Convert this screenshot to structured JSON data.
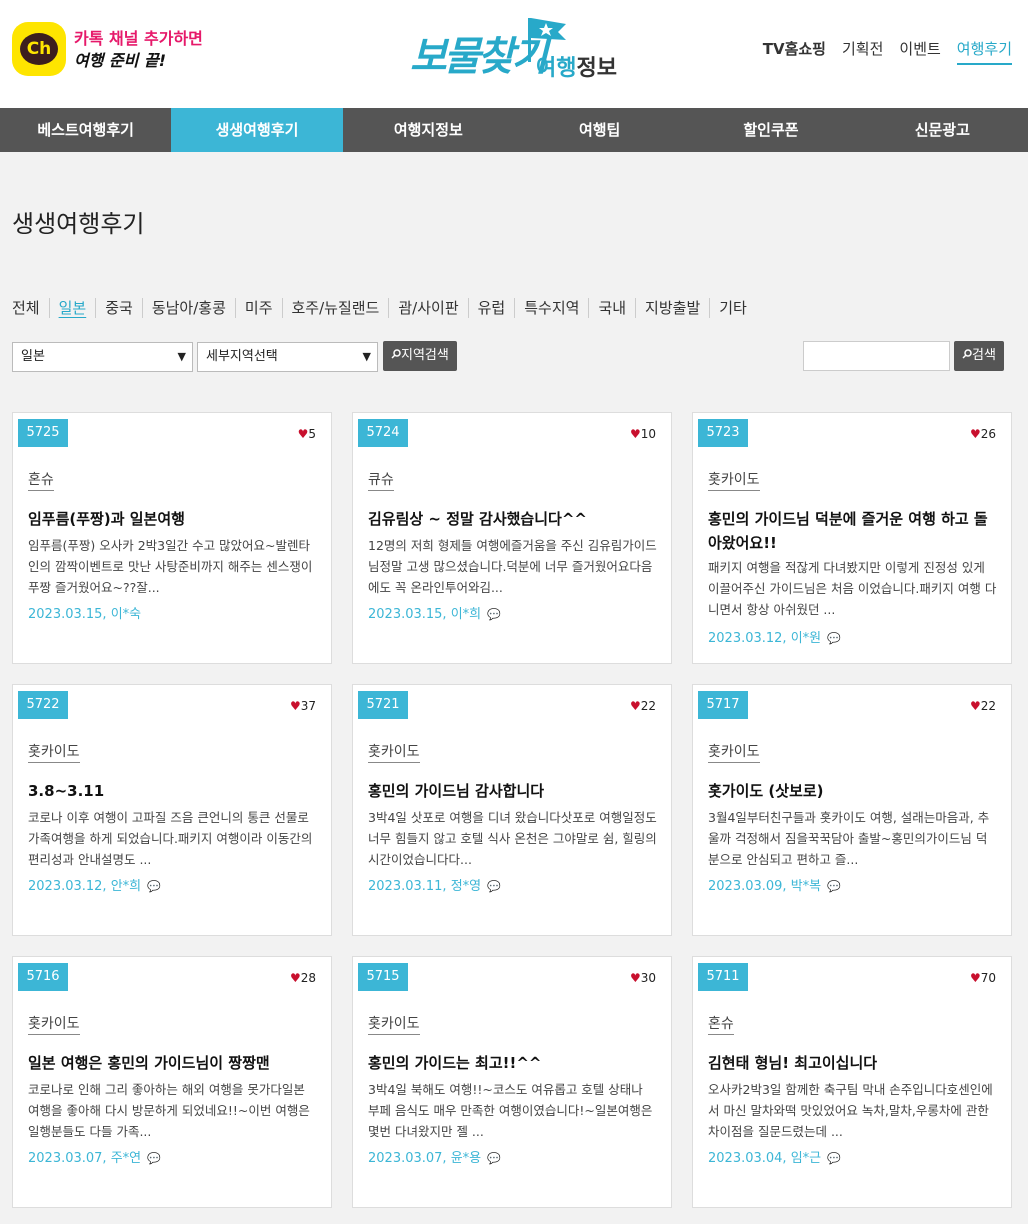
{
  "header": {
    "kakao_icon_text": "Ch",
    "kakao_line1": "카톡 채널 추가하면",
    "kakao_line2": "여행 준비 끝!",
    "brand_main": "보물찾기",
    "brand_sub_a": "여행",
    "brand_sub_b": "정보",
    "topnav": [
      "TV홈쇼핑",
      "기획전",
      "이벤트",
      "여행후기"
    ]
  },
  "mainnav": [
    "베스트여행후기",
    "생생여행후기",
    "여행지정보",
    "여행팁",
    "할인쿠폰",
    "신문광고"
  ],
  "page_title": "생생여행후기",
  "regions": [
    "전체",
    "일본",
    "중국",
    "동남아/홍콩",
    "미주",
    "호주/뉴질랜드",
    "괌/사이판",
    "유럽",
    "특수지역",
    "국내",
    "지방출발",
    "기타"
  ],
  "filters": {
    "country_select": "일본",
    "detail_select": "세부지역선택",
    "region_search_btn": "지역검색",
    "search_btn": "검색",
    "search_value": ""
  },
  "icons": {
    "heart": "heart-icon",
    "comment": "comment-icon",
    "search": "search-icon"
  },
  "colors": {
    "accent": "#3cb6d6",
    "nav_bg": "#555555",
    "heart": "#c8102e"
  },
  "cards": [
    {
      "num": "5725",
      "likes": "5",
      "cat": "혼슈",
      "title": "임푸름(푸짱)과 일본여행",
      "excerpt": "임푸름(푸짱) 오사카 2박3일간 수고 많았어요~발렌타인의 깜짝이벤트로 맛난 사탕준비까지 해주는 센스쟁이 푸짱 즐거웠어요~??잘...",
      "meta": "2023.03.15, 이*숙",
      "comment": false
    },
    {
      "num": "5724",
      "likes": "10",
      "cat": "큐슈",
      "title": "김유림상 ~ 정말 감사했습니다^^",
      "excerpt": "12명의 저희 형제들 여행에즐거움을 주신 김유림가이드님정말 고생 많으셨습니다.덕분에 너무 즐거웠어요다음에도 꼭 온라인투어와김...",
      "meta": "2023.03.15, 이*희",
      "comment": true
    },
    {
      "num": "5723",
      "likes": "26",
      "cat": "홋카이도",
      "title": "홍민의 가이드님 덕분에 즐거운 여행 하고 돌아왔어요!!",
      "excerpt": "패키지 여행을 적잖게 다녀봤지만 이렇게 진정성 있게 이끌어주신 가이드님은 처음 이었습니다.패키지 여행 다니면서 항상 아쉬웠던 ...",
      "meta": "2023.03.12, 이*원",
      "comment": true
    },
    {
      "num": "5722",
      "likes": "37",
      "cat": "홋카이도",
      "title": "3.8~3.11",
      "excerpt": "코로나 이후 여행이 고파질 즈음 큰언니의 통큰 선물로 가족여행을 하게 되었습니다.패키지 여행이라 이동간의 편리성과 안내설명도 ...",
      "meta": "2023.03.12, 안*희",
      "comment": true
    },
    {
      "num": "5721",
      "likes": "22",
      "cat": "홋카이도",
      "title": "홍민의 가이드님 감사합니다",
      "excerpt": "3박4일 삿포로 여행을 디녀 왔습니다삿포로 여행일정도 너무 힘들지 않고 호텔 식사 온천은 그야말로 쉼, 힐링의 시간이었습니다다...",
      "meta": "2023.03.11, 정*영",
      "comment": true
    },
    {
      "num": "5717",
      "likes": "22",
      "cat": "홋카이도",
      "title": "홋가이도 (삿보로)",
      "excerpt": "3월4일부터친구들과 홋카이도 여행, 설래는마음과, 추울까 걱정해서 짐을꾹꾹담아 출발~홍민의가이드님 덕분으로 안심되고 편하고 즐...",
      "meta": "2023.03.09, 박*복",
      "comment": true
    },
    {
      "num": "5716",
      "likes": "28",
      "cat": "홋카이도",
      "title": "일본 여행은 홍민의 가이드님이 짱짱맨",
      "excerpt": "코로나로 인해 그리 좋아하는 해외 여행을 못가다일본 여행을 좋아해 다시 방문하게 되었네요!!~이번 여행은 일행분들도 다들 가족...",
      "meta": "2023.03.07, 주*연",
      "comment": true
    },
    {
      "num": "5715",
      "likes": "30",
      "cat": "홋카이도",
      "title": "홍민의 가이드는 최고!!^^",
      "excerpt": "3박4일 북해도 여행!!~코스도 여유롭고 호텔 상태나 부페 음식도 매우 만족한 여행이였습니다!~일본여행은 몇번 다녀왔지만 젤 ...",
      "meta": "2023.03.07, 윤*용",
      "comment": true
    },
    {
      "num": "5711",
      "likes": "70",
      "cat": "혼슈",
      "title": "김현태 형님! 최고이십니다",
      "excerpt": "오사카2박3일 함께한 축구팀 막내 손주입니다호센인에서 마신 말차와떡 맛있었어요 녹차,말차,우롱차에 관한 차이점을 질문드렸는데 ...",
      "meta": "2023.03.04, 임*근",
      "comment": true
    }
  ]
}
